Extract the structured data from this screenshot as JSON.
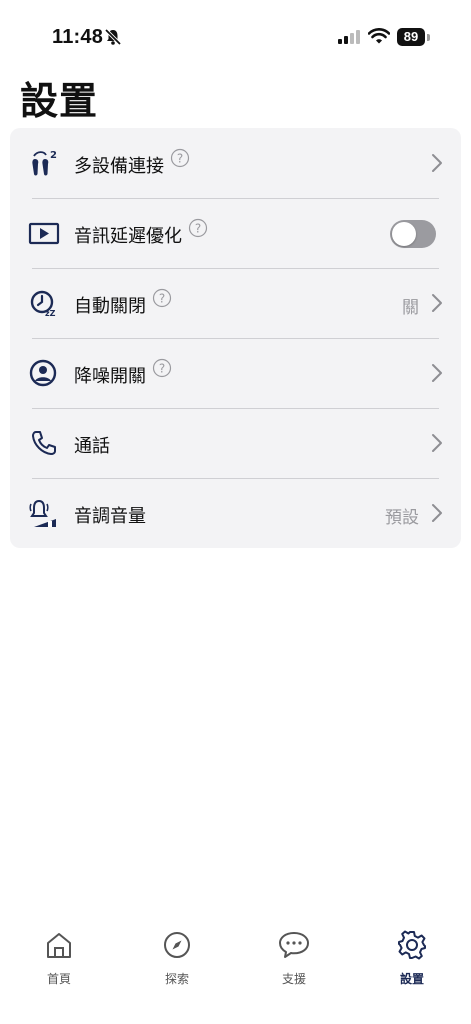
{
  "status_bar": {
    "time": "11:48",
    "battery": "89"
  },
  "page": {
    "title": "設置"
  },
  "settings": {
    "items": [
      {
        "label": "多設備連接",
        "value": ""
      },
      {
        "label": "音訊延遲優化",
        "value": ""
      },
      {
        "label": "自動關閉",
        "value": "關"
      },
      {
        "label": "降噪開關",
        "value": ""
      },
      {
        "label": "通話",
        "value": ""
      },
      {
        "label": "音調音量",
        "value": "預設"
      }
    ],
    "low_latency_toggle": "off"
  },
  "tabbar": {
    "tabs": [
      {
        "label": "首頁",
        "icon": "home-icon"
      },
      {
        "label": "探索",
        "icon": "compass-icon"
      },
      {
        "label": "支援",
        "icon": "chat-bubble-icon"
      },
      {
        "label": "設置",
        "icon": "gear-icon",
        "active": true
      }
    ]
  },
  "colors": {
    "accent": "#1c2a55",
    "card_bg": "#f3f3f5",
    "secondary_text": "#9a9a9f"
  }
}
